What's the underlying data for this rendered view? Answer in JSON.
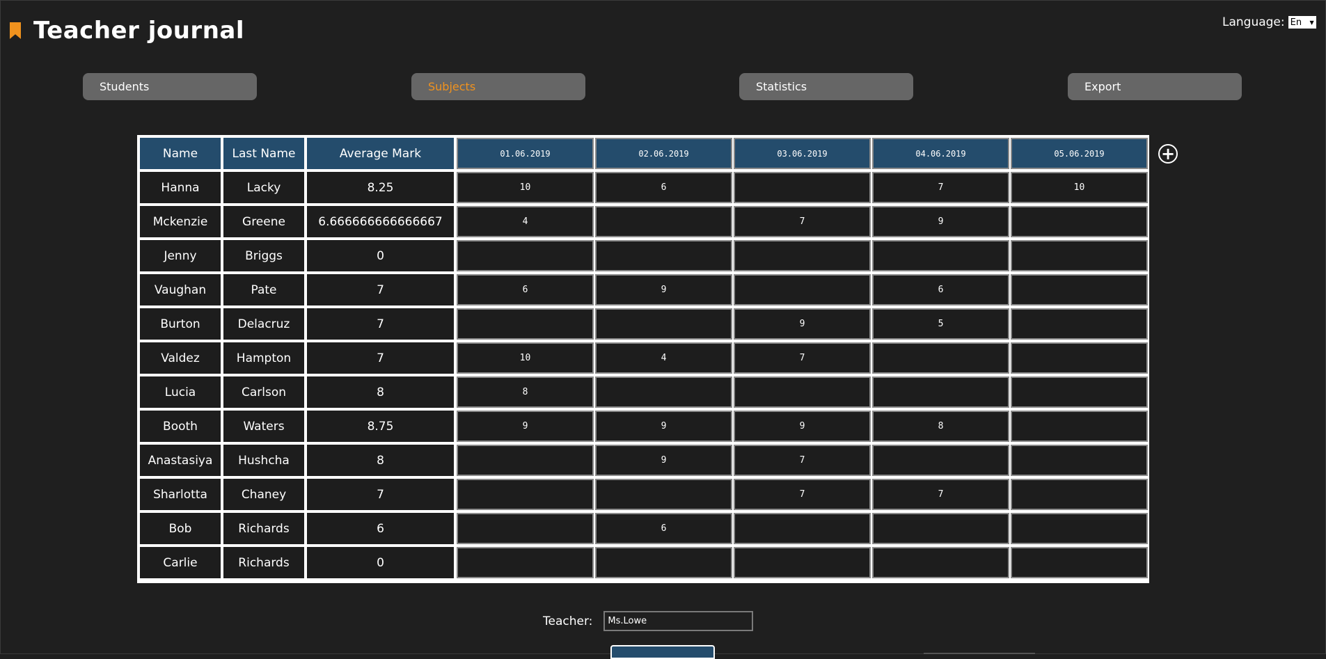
{
  "app": {
    "title": "Teacher journal",
    "accent_color": "#f0921e",
    "icon": "bookmark-icon"
  },
  "language": {
    "label": "Language:",
    "selected": "En"
  },
  "nav": [
    {
      "label": "Students",
      "active": false
    },
    {
      "label": "Subjects",
      "active": true
    },
    {
      "label": "Statistics",
      "active": false
    },
    {
      "label": "Export",
      "active": false
    }
  ],
  "table": {
    "headers": [
      "Name",
      "Last Name",
      "Average Mark"
    ],
    "dates": [
      "01.06.2019",
      "02.06.2019",
      "03.06.2019",
      "04.06.2019",
      "05.06.2019"
    ],
    "rows": [
      {
        "name": "Hanna",
        "last_name": "Lacky",
        "average": "8.25",
        "marks": [
          "10",
          "6",
          "",
          "7",
          "10"
        ]
      },
      {
        "name": "Mckenzie",
        "last_name": "Greene",
        "average": "6.666666666666667",
        "marks": [
          "4",
          "",
          "7",
          "9",
          ""
        ]
      },
      {
        "name": "Jenny",
        "last_name": "Briggs",
        "average": "0",
        "marks": [
          "",
          "",
          "",
          "",
          ""
        ]
      },
      {
        "name": "Vaughan",
        "last_name": "Pate",
        "average": "7",
        "marks": [
          "6",
          "9",
          "",
          "6",
          ""
        ]
      },
      {
        "name": "Burton",
        "last_name": "Delacruz",
        "average": "7",
        "marks": [
          "",
          "",
          "9",
          "5",
          ""
        ]
      },
      {
        "name": "Valdez",
        "last_name": "Hampton",
        "average": "7",
        "marks": [
          "10",
          "4",
          "7",
          "",
          ""
        ]
      },
      {
        "name": "Lucia",
        "last_name": "Carlson",
        "average": "8",
        "marks": [
          "8",
          "",
          "",
          "",
          ""
        ]
      },
      {
        "name": "Booth",
        "last_name": "Waters",
        "average": "8.75",
        "marks": [
          "9",
          "9",
          "9",
          "8",
          ""
        ]
      },
      {
        "name": "Anastasiya",
        "last_name": "Hushcha",
        "average": "8",
        "marks": [
          "",
          "9",
          "7",
          "",
          ""
        ]
      },
      {
        "name": "Sharlotta",
        "last_name": "Chaney",
        "average": "7",
        "marks": [
          "",
          "",
          "7",
          "7",
          ""
        ]
      },
      {
        "name": "Bob",
        "last_name": "Richards",
        "average": "6",
        "marks": [
          "",
          "6",
          "",
          "",
          ""
        ]
      },
      {
        "name": "Carlie",
        "last_name": "Richards",
        "average": "0",
        "marks": [
          "",
          "",
          "",
          "",
          ""
        ]
      }
    ],
    "add_column_icon": "plus-circle-icon"
  },
  "teacher": {
    "label": "Teacher:",
    "value": "Ms.Lowe"
  }
}
